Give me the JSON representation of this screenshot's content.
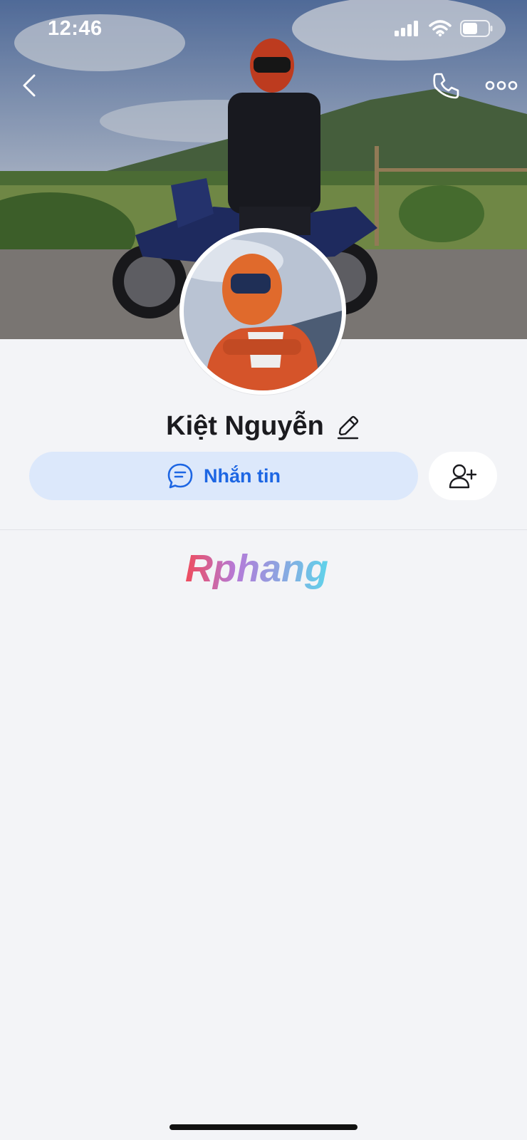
{
  "status_bar": {
    "time": "12:46",
    "signal_icon": "signal-bars-icon",
    "wifi_icon": "wifi-icon",
    "battery_icon": "battery-icon"
  },
  "header": {
    "back_icon": "chevron-left-icon",
    "call_icon": "phone-icon",
    "more_icon": "more-horizontal-icon"
  },
  "cover": {
    "description_icon": "cover-photo"
  },
  "profile": {
    "name": "Kiệt Nguyễn",
    "edit_icon": "pencil-icon"
  },
  "actions": {
    "message_label": "Nhắn tin",
    "message_icon": "chat-bubble-icon",
    "add_friend_icon": "add-user-icon",
    "accent_color": "#1d66e3",
    "button_bg": "#dce8fb"
  },
  "watermark": {
    "text": "Rphang"
  }
}
